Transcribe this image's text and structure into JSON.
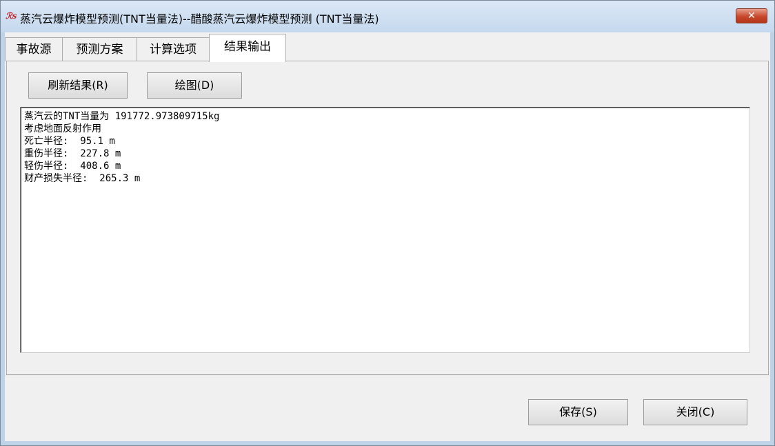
{
  "window": {
    "title": "蒸汽云爆炸模型预测(TNT当量法)--醋酸蒸汽云爆炸模型预测 (TNT当量法)",
    "icon": "rs-logo-icon",
    "close_label": "✕"
  },
  "tabs": [
    {
      "label": "事故源",
      "active": false
    },
    {
      "label": "预测方案",
      "active": false
    },
    {
      "label": "计算选项",
      "active": false
    },
    {
      "label": "结果输出",
      "active": true
    }
  ],
  "toolbar": {
    "refresh_label": "刷新结果(R)",
    "plot_label": "绘图(D)"
  },
  "results": {
    "lines": [
      "蒸汽云的TNT当量为 191772.973809715kg",
      "考虑地面反射作用",
      "死亡半径:  95.1 m",
      "重伤半径:  227.8 m",
      "轻伤半径:  408.6 m",
      "财产损失半径:  265.3 m"
    ]
  },
  "footer": {
    "save_label": "保存(S)",
    "close_label": "关闭(C)"
  }
}
